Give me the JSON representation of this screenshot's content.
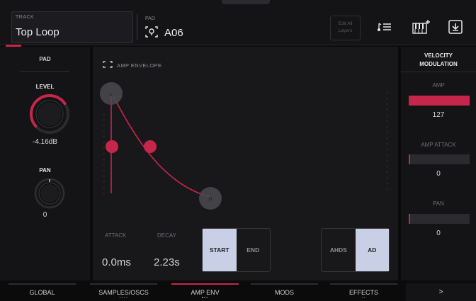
{
  "header": {
    "track_caption": "TRACK",
    "track_name": "Top Loop",
    "pad_caption": "PAD",
    "pad_name": "A06",
    "edit_all_line1": "Edit All",
    "edit_all_line2": "Layers",
    "tempo_icon": "metronome-list-icon",
    "keyboard_icon": "keyboard-add-icon",
    "save_icon": "save-download-icon"
  },
  "pad_panel": {
    "title": "PAD",
    "level_label": "LEVEL",
    "level_value": "-4.16dB",
    "level_fraction": 0.72,
    "pan_label": "PAN",
    "pan_value": "0"
  },
  "envelope": {
    "title": "AMP ENVELOPE",
    "attack_label": "ATTACK",
    "attack_value": "0.0ms",
    "decay_label": "DECAY",
    "decay_value": "2.23s",
    "point_a": "A",
    "point_d": "D",
    "start_label": "START",
    "end_label": "END",
    "ahds_label": "AHDS",
    "ad_label": "AD",
    "start_active": true,
    "ad_active": true
  },
  "velocity_modulation": {
    "title_line1": "VELOCITY",
    "title_line2": "MODULATION",
    "amp_label": "AMP",
    "amp_value": "127",
    "amp_fraction": 1.0,
    "amp_attack_label": "AMP ATTACK",
    "amp_attack_value": "0",
    "amp_attack_fraction": 0.0,
    "pan_label": "PAN",
    "pan_value": "0",
    "pan_fraction": 0.0
  },
  "tabs": [
    "GLOBAL",
    "SAMPLES/OSCS",
    "AMP ENV",
    "MODS",
    "EFFECTS",
    ">"
  ],
  "active_tab": "AMP ENV",
  "colors": {
    "accent": "#c8254a",
    "toggle_on": "#c9d0e6",
    "background": "#0b0b0c"
  }
}
